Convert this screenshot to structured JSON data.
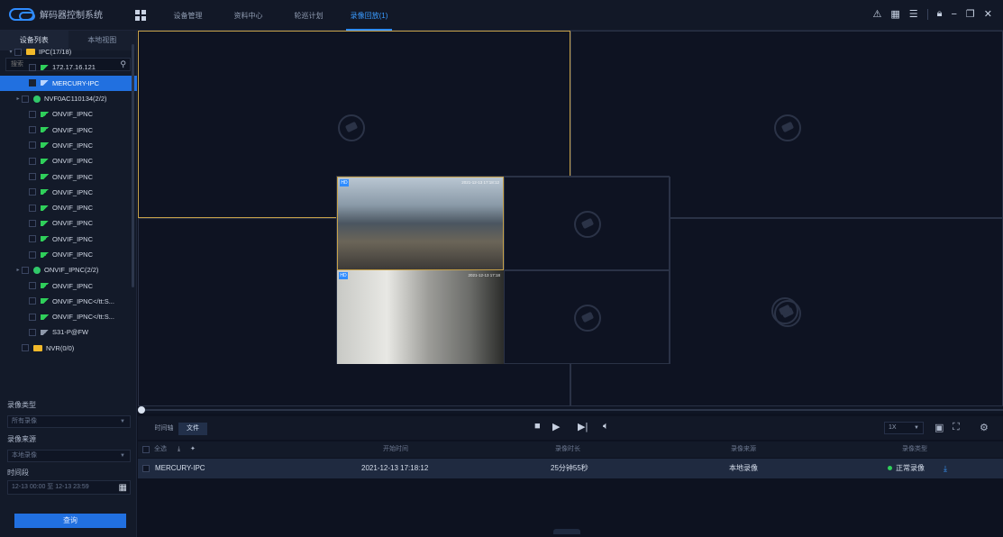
{
  "app": {
    "title": "解码器控制系统"
  },
  "nav": {
    "tabs": [
      "设备管理",
      "资料中心",
      "轮巡计划",
      "录像回放(1)"
    ]
  },
  "sidebar": {
    "tabs": [
      "设备列表",
      "本地视图"
    ],
    "search_placeholder": "搜索",
    "tree": [
      {
        "label": "IPC(17/18)",
        "type": "folder",
        "caret": "▾",
        "indent": 0
      },
      {
        "label": "172.17.16.121",
        "type": "cam",
        "indent": 2
      },
      {
        "label": "MERCURY-IPC",
        "type": "cam",
        "indent": 2,
        "selected": true
      },
      {
        "label": "NVF0AC110134(2/2)",
        "type": "nvr",
        "caret": "▸",
        "indent": 1
      },
      {
        "label": "ONVIF_IPNC",
        "type": "cam",
        "indent": 2
      },
      {
        "label": "ONVIF_IPNC",
        "type": "cam",
        "indent": 2
      },
      {
        "label": "ONVIF_IPNC",
        "type": "cam",
        "indent": 2
      },
      {
        "label": "ONVIF_IPNC",
        "type": "cam",
        "indent": 2
      },
      {
        "label": "ONVIF_IPNC",
        "type": "cam",
        "indent": 2
      },
      {
        "label": "ONVIF_IPNC",
        "type": "cam",
        "indent": 2
      },
      {
        "label": "ONVIF_IPNC",
        "type": "cam",
        "indent": 2
      },
      {
        "label": "ONVIF_IPNC",
        "type": "cam",
        "indent": 2
      },
      {
        "label": "ONVIF_IPNC",
        "type": "cam",
        "indent": 2
      },
      {
        "label": "ONVIF_IPNC",
        "type": "cam",
        "indent": 2
      },
      {
        "label": "ONVIF_IPNC(2/2)",
        "type": "nvr",
        "caret": "▸",
        "indent": 1
      },
      {
        "label": "ONVIF_IPNC",
        "type": "cam",
        "indent": 2
      },
      {
        "label": "ONVIF_IPNC</tt:S...",
        "type": "cam",
        "indent": 2
      },
      {
        "label": "ONVIF_IPNC</tt:S...",
        "type": "cam",
        "indent": 2
      },
      {
        "label": "S31-P@FW",
        "type": "cam-gray",
        "indent": 2
      },
      {
        "label": "NVR(0/0)",
        "type": "folder",
        "indent": 1
      }
    ],
    "record_type_label": "录像类型",
    "record_type_value": "所有录像",
    "record_source_label": "录像来源",
    "record_source_value": "本地录像",
    "time_label": "时间段",
    "time_value": "12-13 00:00 至 12-13 23:59",
    "query_label": "查询"
  },
  "video": {
    "badge": "HD",
    "osd_top": "2021-12-13 17:18:12",
    "osd_bottom": "2021-12-13 17:18"
  },
  "controls": {
    "mode_tabs": [
      "时间轴",
      "文件"
    ],
    "speed": "1X"
  },
  "table": {
    "select_all": "全选",
    "headers": [
      "开始时间",
      "录像时长",
      "录像来源",
      "录像类型"
    ],
    "rows": [
      {
        "name": "MERCURY-IPC",
        "start": "2021-12-13 17:18:12",
        "duration": "25分钟55秒",
        "source": "本地录像",
        "type": "正常录像"
      }
    ]
  }
}
